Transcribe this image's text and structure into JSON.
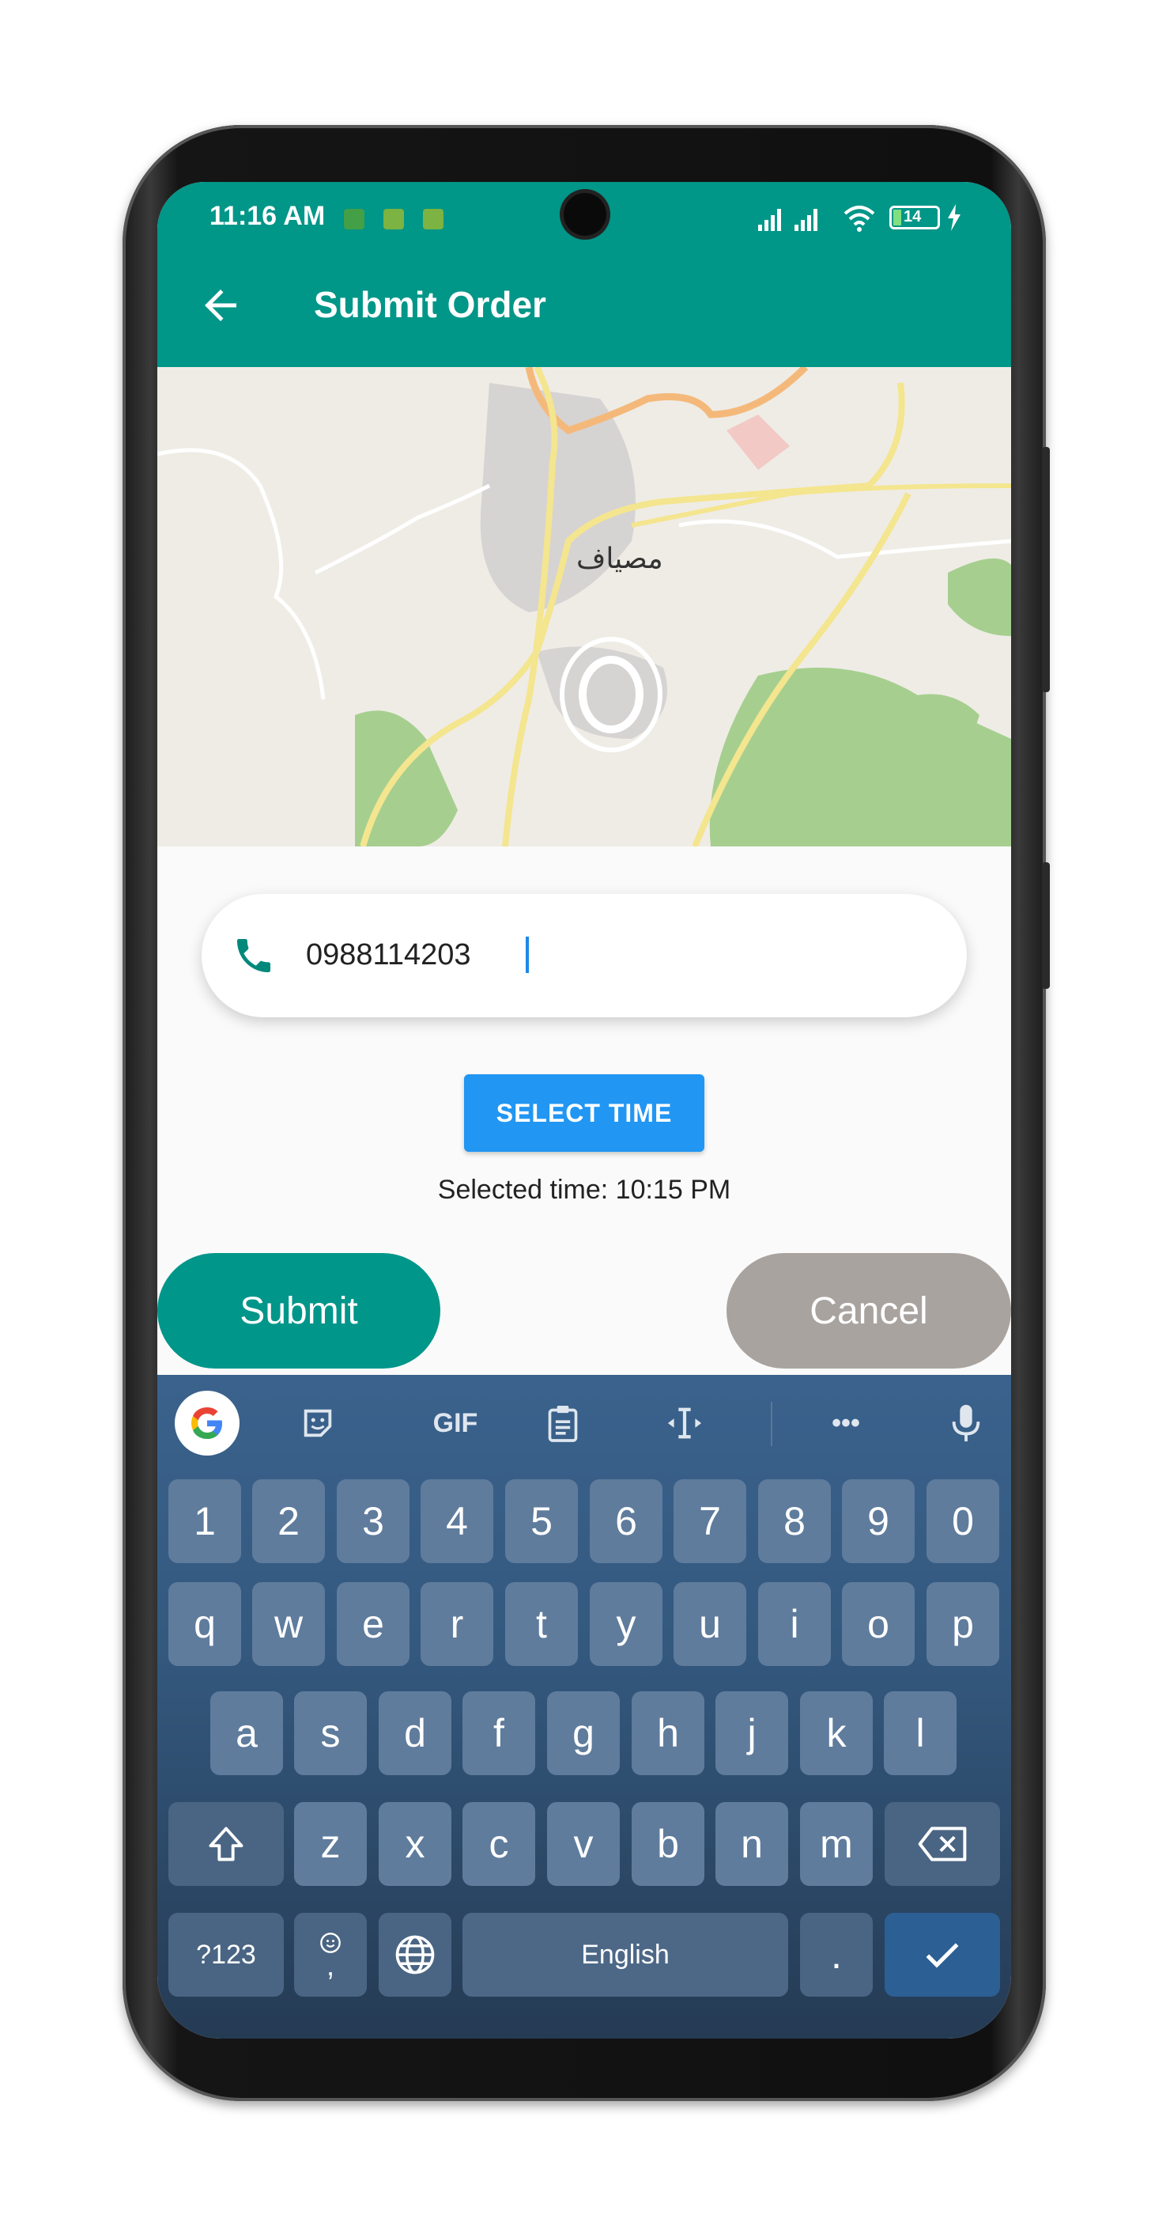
{
  "status_bar": {
    "time": "11:16 AM",
    "battery": "14"
  },
  "app_bar": {
    "title": "Submit Order"
  },
  "map": {
    "place_label": "مصياف"
  },
  "form": {
    "phone_value": "0988114203",
    "select_time_label": "SELECT TIME",
    "selected_time_text": "Selected time: 10:15 PM",
    "submit_label": "Submit",
    "cancel_label": "Cancel"
  },
  "keyboard": {
    "toolbar": {
      "gif_label": "GIF",
      "more_label": "•••"
    },
    "row_numbers": [
      "1",
      "2",
      "3",
      "4",
      "5",
      "6",
      "7",
      "8",
      "9",
      "0"
    ],
    "row_1": [
      "q",
      "w",
      "e",
      "r",
      "t",
      "y",
      "u",
      "i",
      "o",
      "p"
    ],
    "row_2": [
      "a",
      "s",
      "d",
      "f",
      "g",
      "h",
      "j",
      "k",
      "l"
    ],
    "row_3": [
      "z",
      "x",
      "c",
      "v",
      "b",
      "n",
      "m"
    ],
    "symbols_label": "?123",
    "comma_label": ",",
    "space_label": "English",
    "period_label": "."
  },
  "colors": {
    "primary": "#009688",
    "select_time_button": "#2196f3",
    "cancel_button": "#a9a39f",
    "keyboard_bg": "#34597f"
  }
}
